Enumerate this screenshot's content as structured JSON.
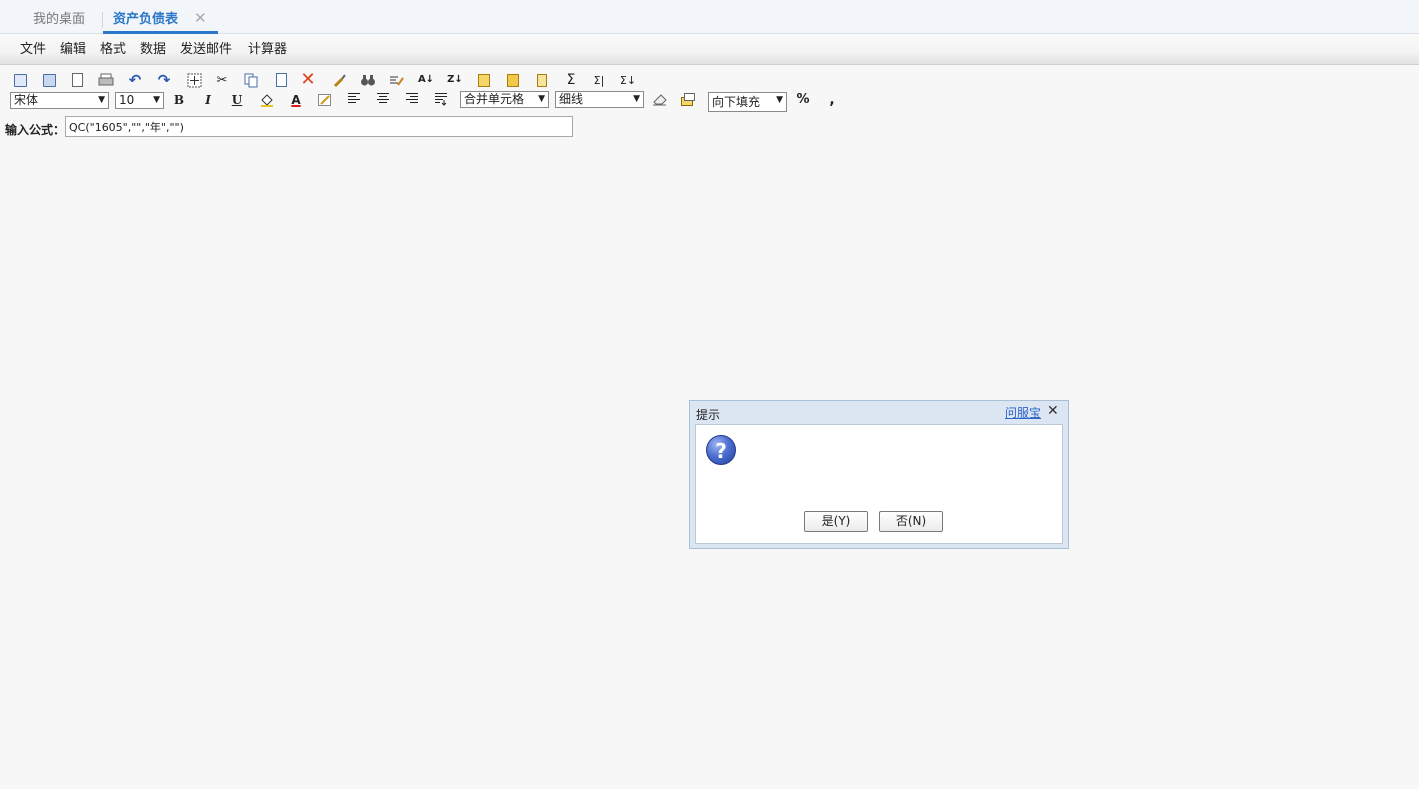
{
  "tabs": [
    {
      "label": "我的桌面"
    },
    {
      "label": "资产负债表",
      "close": "✕"
    }
  ],
  "menu": [
    "文件",
    "编辑",
    "格式",
    "数据",
    "发送邮件",
    "计算器"
  ],
  "toolbar": {
    "font_name": "宋体",
    "font_size": "10",
    "merge": "合并单元格",
    "border": "细线",
    "fill": "向下填充",
    "bold": "B",
    "italic": "I",
    "underline": "U",
    "font_color": "A",
    "percent": "%",
    "comma": ",",
    "sum": "Σ",
    "sum_row": "Σ|",
    "sum_col": "Σ↓"
  },
  "formula": {
    "label": "输入公式：",
    "value": "QC(\"1605\",\"\",\"年\",\"\")"
  },
  "dialog": {
    "title": "提示",
    "help_link": "问服宝",
    "close": "✕",
    "icon": "?",
    "yes_label": "是(Y)",
    "no_label": "否(N)"
  },
  "colors": {
    "accent": "#2b77c9",
    "dialog_frame": "#dbe6f2",
    "background": "#f7f7f7"
  }
}
